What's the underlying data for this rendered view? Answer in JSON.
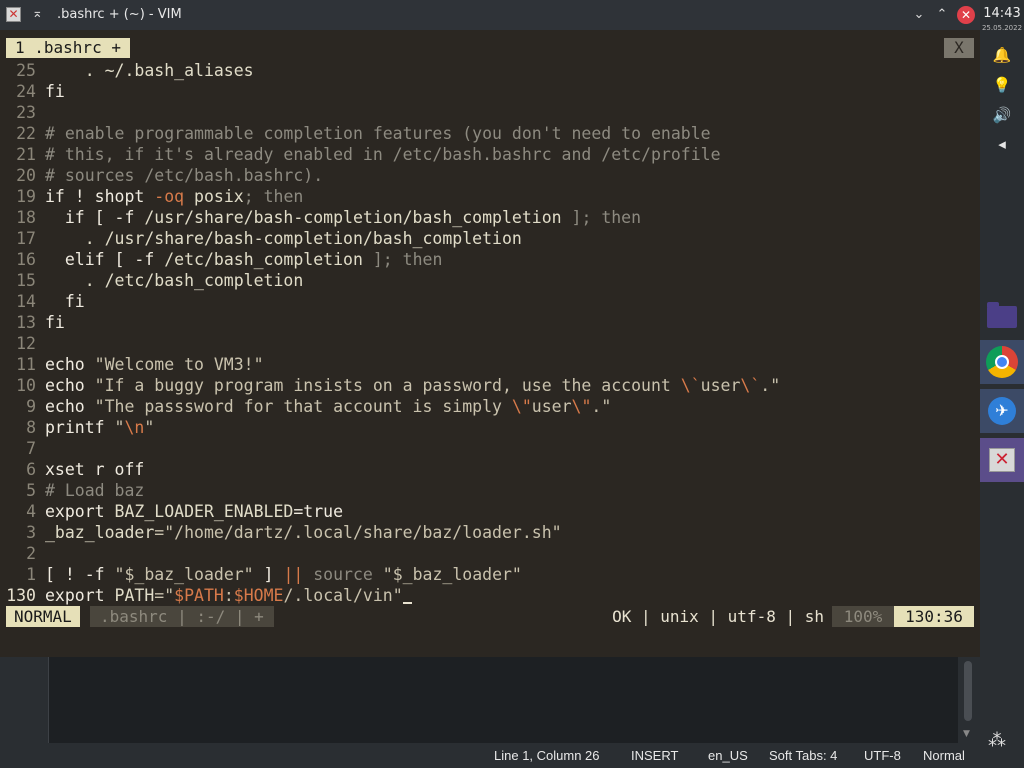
{
  "titlebar": {
    "title": ".bashrc + (~) - VIM",
    "app_icon": "✕",
    "pin_icon": "⌅",
    "minimize_icon": "⌄",
    "maximize_icon": "⌃",
    "close_icon": "✕"
  },
  "panel": {
    "time": "14:43",
    "date": "25.05.2022",
    "icons": [
      "bell-icon",
      "lightbulb-icon",
      "speaker-icon",
      "arrow-left-icon"
    ],
    "bell": "🔔",
    "bulb": "💡",
    "speaker": "🔊",
    "arrow": "◂",
    "tasks": [
      "folder",
      "chrome",
      "kdeconnect",
      "vim"
    ],
    "kdeconnect_glyph": "✈",
    "vim_glyph": "✕"
  },
  "vim": {
    "tab_label": "1 .bashrc +",
    "tab_close": "X",
    "lines": [
      {
        "n": "25",
        "segs": [
          [
            "    . ~/.bash_aliases",
            "var"
          ]
        ]
      },
      {
        "n": "24",
        "segs": [
          [
            "fi",
            "kw"
          ]
        ]
      },
      {
        "n": "23",
        "segs": []
      },
      {
        "n": "22",
        "segs": [
          [
            "# enable programmable completion features (you don't need to enable",
            "cm"
          ]
        ]
      },
      {
        "n": "21",
        "segs": [
          [
            "# this, if it's already enabled in /etc/bash.bashrc and /etc/profile",
            "cm"
          ]
        ]
      },
      {
        "n": "20",
        "segs": [
          [
            "# sources /etc/bash.bashrc).",
            "cm"
          ]
        ]
      },
      {
        "n": "19",
        "segs": [
          [
            "if ! shopt ",
            "kw"
          ],
          [
            "-oq",
            "op"
          ],
          [
            " posix",
            "var"
          ],
          [
            "; then",
            "cm"
          ]
        ]
      },
      {
        "n": "18",
        "segs": [
          [
            "  if [ -f ",
            "kw"
          ],
          [
            "/usr/share/bash-completion/bash_completion",
            "var"
          ],
          [
            " ]; then",
            "cm"
          ]
        ]
      },
      {
        "n": "17",
        "segs": [
          [
            "    . /usr/share/bash-completion/bash_completion",
            "var"
          ]
        ]
      },
      {
        "n": "16",
        "segs": [
          [
            "  elif [ -f ",
            "kw"
          ],
          [
            "/etc/bash_completion",
            "var"
          ],
          [
            " ]; then",
            "cm"
          ]
        ]
      },
      {
        "n": "15",
        "segs": [
          [
            "    . /etc/bash_completion",
            "var"
          ]
        ]
      },
      {
        "n": "14",
        "segs": [
          [
            "  fi",
            "kw"
          ]
        ]
      },
      {
        "n": "13",
        "segs": [
          [
            "fi",
            "kw"
          ]
        ]
      },
      {
        "n": "12",
        "segs": []
      },
      {
        "n": "11",
        "segs": [
          [
            "echo ",
            "kw"
          ],
          [
            "\"Welcome to VM3!\"",
            "st"
          ]
        ]
      },
      {
        "n": "10",
        "segs": [
          [
            "echo ",
            "kw"
          ],
          [
            "\"If a buggy program insists on a password, use the account ",
            "st"
          ],
          [
            "\\`",
            "op"
          ],
          [
            "user",
            "st"
          ],
          [
            "\\`",
            "op"
          ],
          [
            ".\"",
            "st"
          ]
        ]
      },
      {
        "n": "9",
        "segs": [
          [
            "echo ",
            "kw"
          ],
          [
            "\"The passsword for that account is simply ",
            "st"
          ],
          [
            "\\\"",
            "op"
          ],
          [
            "user",
            "st"
          ],
          [
            "\\\"",
            "op"
          ],
          [
            ".\"",
            "st"
          ]
        ]
      },
      {
        "n": "8",
        "segs": [
          [
            "printf ",
            "kw"
          ],
          [
            "\"",
            "st"
          ],
          [
            "\\n",
            "op"
          ],
          [
            "\"",
            "st"
          ]
        ]
      },
      {
        "n": "7",
        "segs": []
      },
      {
        "n": "6",
        "segs": [
          [
            "xset r off",
            "kw"
          ]
        ]
      },
      {
        "n": "5",
        "segs": [
          [
            "# Load baz",
            "cm"
          ]
        ]
      },
      {
        "n": "4",
        "segs": [
          [
            "export ",
            "kw"
          ],
          [
            "BAZ_LOADER_ENABLED",
            "var"
          ],
          [
            "=true",
            "kw"
          ]
        ]
      },
      {
        "n": "3",
        "segs": [
          [
            "_baz_loader",
            "var"
          ],
          [
            "=\"/home/dartz/.local/share/baz/loader.sh\"",
            "st"
          ]
        ]
      },
      {
        "n": "2",
        "segs": []
      },
      {
        "n": "1",
        "segs": [
          [
            "[ ! -f ",
            "kw"
          ],
          [
            "\"$_baz_loader\"",
            "st"
          ],
          [
            " ] ",
            "kw"
          ],
          [
            "||",
            "op"
          ],
          [
            " source ",
            "cm"
          ],
          [
            "\"$_baz_loader\"",
            "st"
          ]
        ]
      },
      {
        "n": "130",
        "cur": true,
        "segs": [
          [
            "export ",
            "kw"
          ],
          [
            "PATH",
            "var"
          ],
          [
            "=\"",
            "st"
          ],
          [
            "$PATH",
            "op"
          ],
          [
            ":",
            "st"
          ],
          [
            "$HOME",
            "op"
          ],
          [
            "/.local/vin\"",
            "st"
          ]
        ]
      }
    ],
    "status": {
      "mode": "NORMAL",
      "file": ".bashrc  |  :-/  |  +",
      "info": "OK | unix | utf-8 | sh",
      "percent": "100%",
      "position": "130:36"
    }
  },
  "statusbar": {
    "line_col": "Line 1, Column 26",
    "mode": "INSERT",
    "lang": "en_US",
    "tabs": "Soft Tabs: 4",
    "encoding": "UTF-8",
    "state": "Normal"
  }
}
